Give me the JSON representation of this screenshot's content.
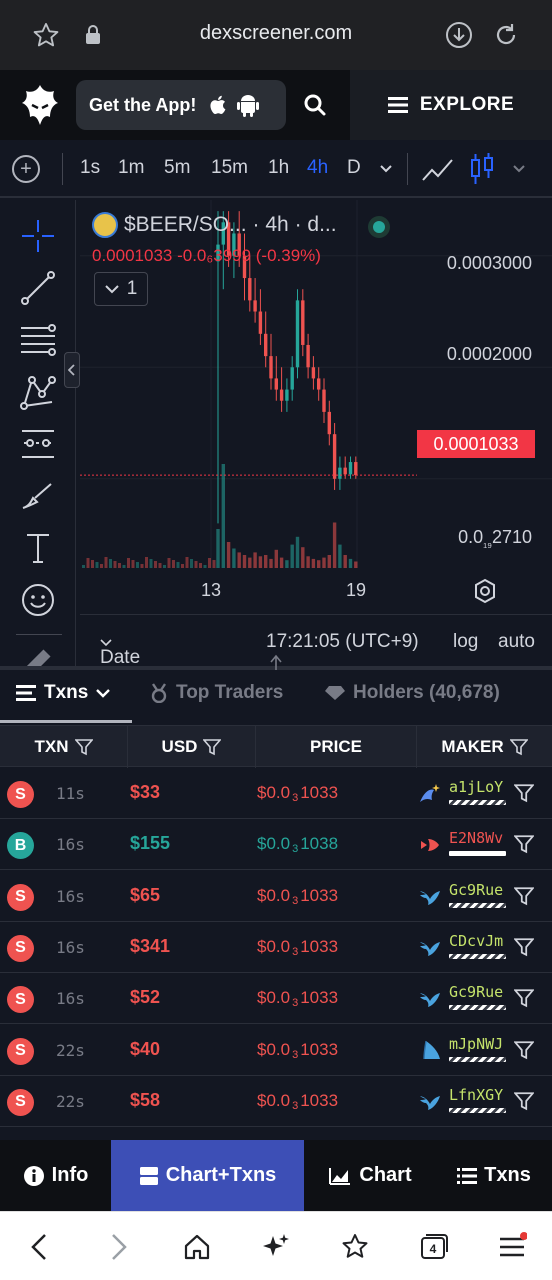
{
  "browser": {
    "url": "dexscreener.com",
    "tabs_count": "4"
  },
  "header": {
    "get_app": "Get the App!",
    "explore": "EXPLORE"
  },
  "timeframes": [
    "1s",
    "1m",
    "5m",
    "15m",
    "1h",
    "4h",
    "D"
  ],
  "active_timeframe": "4h",
  "chart": {
    "symbol": "$BEER/SO...",
    "interval": "· 4h · d...",
    "ohlc": "0.0001033  -0.0₆3999 (-0.39%)",
    "legend_count": "1",
    "current_price": "0.0001033",
    "price_labels": [
      "0.0003000",
      "0.0002000"
    ],
    "bottom_price_prefix": "0.0",
    "bottom_price_sub": "₁₉",
    "bottom_price_suffix": "2710",
    "x_labels": [
      "13",
      "19"
    ],
    "date_range": "Date Range",
    "time": "17:21:05 (UTC+9)",
    "log": "log",
    "auto": "auto",
    "candles": [
      {
        "o": 0.000295,
        "h": 0.00034,
        "l": 6e-05,
        "c": 0.00031,
        "v": 30
      },
      {
        "o": 0.00031,
        "h": 0.00034,
        "l": 0.00027,
        "c": 0.00033,
        "v": 80
      },
      {
        "o": 0.00033,
        "h": 0.00034,
        "l": 0.00029,
        "c": 0.0003,
        "v": 20
      },
      {
        "o": 0.0003,
        "h": 0.00033,
        "l": 0.00028,
        "c": 0.00032,
        "v": 15
      },
      {
        "o": 0.00032,
        "h": 0.00034,
        "l": 0.00029,
        "c": 0.0003,
        "v": 12
      },
      {
        "o": 0.0003,
        "h": 0.00032,
        "l": 0.00026,
        "c": 0.00028,
        "v": 10
      },
      {
        "o": 0.00028,
        "h": 0.0003,
        "l": 0.00025,
        "c": 0.00026,
        "v": 8
      },
      {
        "o": 0.00026,
        "h": 0.00028,
        "l": 0.00024,
        "c": 0.00025,
        "v": 12
      },
      {
        "o": 0.00025,
        "h": 0.00027,
        "l": 0.00022,
        "c": 0.00023,
        "v": 9
      },
      {
        "o": 0.00023,
        "h": 0.00025,
        "l": 0.0002,
        "c": 0.00021,
        "v": 10
      },
      {
        "o": 0.00021,
        "h": 0.00023,
        "l": 0.00018,
        "c": 0.00019,
        "v": 7
      },
      {
        "o": 0.00019,
        "h": 0.00021,
        "l": 0.00017,
        "c": 0.00018,
        "v": 14
      },
      {
        "o": 0.00018,
        "h": 0.0002,
        "l": 0.00016,
        "c": 0.00017,
        "v": 8
      },
      {
        "o": 0.00017,
        "h": 0.00019,
        "l": 0.00016,
        "c": 0.00018,
        "v": 6
      },
      {
        "o": 0.00018,
        "h": 0.00021,
        "l": 0.00017,
        "c": 0.0002,
        "v": 18
      },
      {
        "o": 0.0002,
        "h": 0.00027,
        "l": 0.00019,
        "c": 0.00026,
        "v": 24
      },
      {
        "o": 0.00026,
        "h": 0.00027,
        "l": 0.00021,
        "c": 0.00022,
        "v": 16
      },
      {
        "o": 0.00022,
        "h": 0.00023,
        "l": 0.00019,
        "c": 0.0002,
        "v": 9
      },
      {
        "o": 0.0002,
        "h": 0.00021,
        "l": 0.00018,
        "c": 0.00019,
        "v": 7
      },
      {
        "o": 0.00019,
        "h": 0.0002,
        "l": 0.00017,
        "c": 0.00018,
        "v": 6
      },
      {
        "o": 0.00018,
        "h": 0.00019,
        "l": 0.00015,
        "c": 0.00016,
        "v": 8
      },
      {
        "o": 0.00016,
        "h": 0.00017,
        "l": 0.00013,
        "c": 0.00014,
        "v": 10
      },
      {
        "o": 0.00014,
        "h": 0.00015,
        "l": 9e-05,
        "c": 0.0001,
        "v": 35
      },
      {
        "o": 0.0001,
        "h": 0.00012,
        "l": 9e-05,
        "c": 0.00011,
        "v": 18
      },
      {
        "o": 0.00011,
        "h": 0.00012,
        "l": 0.0001,
        "c": 0.000104,
        "v": 10
      },
      {
        "o": 0.000104,
        "h": 0.00012,
        "l": 0.0001,
        "c": 0.000115,
        "v": 7
      },
      {
        "o": 0.000115,
        "h": 0.00012,
        "l": 0.0001,
        "c": 0.0001033,
        "v": 5
      }
    ]
  },
  "tabs": {
    "txns": "Txns",
    "top_traders": "Top Traders",
    "holders": "Holders (40,678)"
  },
  "table": {
    "headers": [
      "TXN",
      "USD",
      "PRICE",
      "MAKER"
    ],
    "rows": [
      {
        "type": "S",
        "age": "11s",
        "usd": "$33",
        "price_a": "$0.0",
        "price_sub": "3",
        "price_b": "1033",
        "maker": "a1jLoY",
        "maker_color": "#c4e36b",
        "icon": "sparkle-whale-icon",
        "bar": "striped"
      },
      {
        "type": "B",
        "age": "16s",
        "usd": "$155",
        "price_a": "$0.0",
        "price_sub": "3",
        "price_b": "1038",
        "maker": "E2N8Wv",
        "maker_color": "#ef5350",
        "icon": "fish-icon",
        "bar": "solid"
      },
      {
        "type": "S",
        "age": "16s",
        "usd": "$65",
        "price_a": "$0.0",
        "price_sub": "3",
        "price_b": "1033",
        "maker": "Gc9Rue",
        "maker_color": "#c4e36b",
        "icon": "bird-icon",
        "bar": "striped"
      },
      {
        "type": "S",
        "age": "16s",
        "usd": "$341",
        "price_a": "$0.0",
        "price_sub": "3",
        "price_b": "1033",
        "maker": "CDcvJm",
        "maker_color": "#c4e36b",
        "icon": "bird-icon",
        "bar": "striped"
      },
      {
        "type": "S",
        "age": "16s",
        "usd": "$52",
        "price_a": "$0.0",
        "price_sub": "3",
        "price_b": "1033",
        "maker": "Gc9Rue",
        "maker_color": "#c4e36b",
        "icon": "bird-icon",
        "bar": "striped"
      },
      {
        "type": "S",
        "age": "22s",
        "usd": "$40",
        "price_a": "$0.0",
        "price_sub": "3",
        "price_b": "1033",
        "maker": "mJpNWJ",
        "maker_color": "#c4e36b",
        "icon": "shell-icon",
        "bar": "striped"
      },
      {
        "type": "S",
        "age": "22s",
        "usd": "$58",
        "price_a": "$0.0",
        "price_sub": "3",
        "price_b": "1033",
        "maker": "LfnXGY",
        "maker_color": "#c4e36b",
        "icon": "bird-icon",
        "bar": "striped"
      }
    ]
  },
  "bottom_tabs": {
    "info": "Info",
    "chart_txns": "Chart+Txns",
    "chart": "Chart",
    "txns": "Txns"
  },
  "colors": {
    "sell": "#ef5350",
    "buy": "#26a69a",
    "accent": "#2962ff",
    "active_tab": "#3d4fb6"
  }
}
